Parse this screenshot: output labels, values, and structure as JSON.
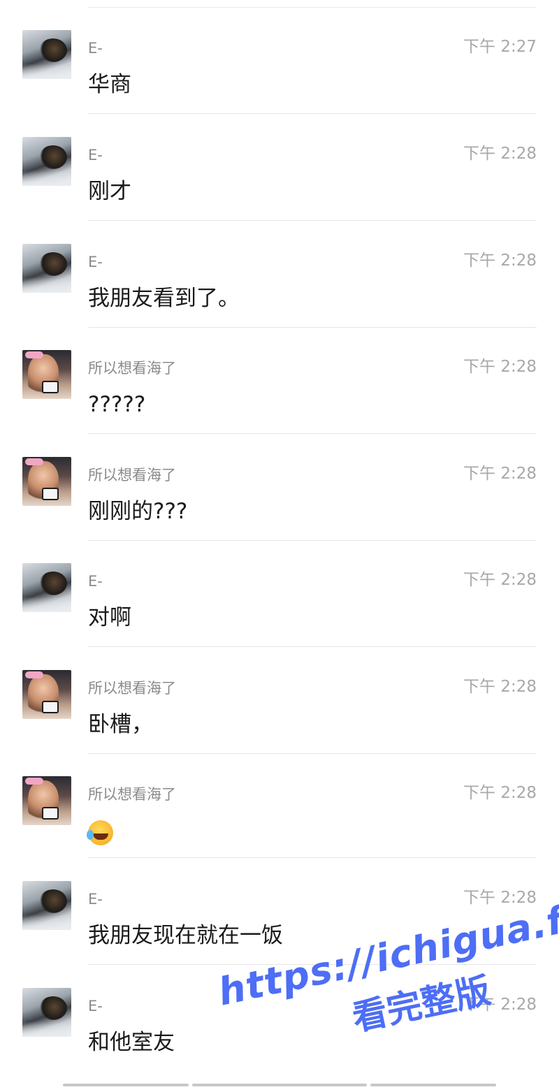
{
  "messages": [
    {
      "sender": "E-",
      "time": "下午 2:27",
      "text": "华商",
      "avatar": "male-avatar"
    },
    {
      "sender": "E-",
      "time": "下午 2:28",
      "text": "刚才",
      "avatar": "male-avatar"
    },
    {
      "sender": "E-",
      "time": "下午 2:28",
      "text": "我朋友看到了。",
      "avatar": "male-avatar"
    },
    {
      "sender": "所以想看海了",
      "time": "下午 2:28",
      "text": "?????",
      "avatar": "female-avatar"
    },
    {
      "sender": "所以想看海了",
      "time": "下午 2:28",
      "text": "刚刚的???",
      "avatar": "female-avatar"
    },
    {
      "sender": "E-",
      "time": "下午 2:28",
      "text": "对啊",
      "avatar": "male-avatar"
    },
    {
      "sender": "所以想看海了",
      "time": "下午 2:28",
      "text": "卧槽，",
      "avatar": "female-avatar"
    },
    {
      "sender": "所以想看海了",
      "time": "下午 2:28",
      "text": "",
      "emoji": "laugh-cry-emoji",
      "avatar": "female-avatar"
    },
    {
      "sender": "E-",
      "time": "下午 2:28",
      "text": "我朋友现在就在一饭",
      "avatar": "male-avatar"
    },
    {
      "sender": "E-",
      "time": "下午 2:28",
      "text": "和他室友",
      "avatar": "male-avatar"
    }
  ],
  "watermark": {
    "url": "https://ichigua.fun",
    "subtitle": "看完整版",
    "color": "#4d6ef5"
  }
}
